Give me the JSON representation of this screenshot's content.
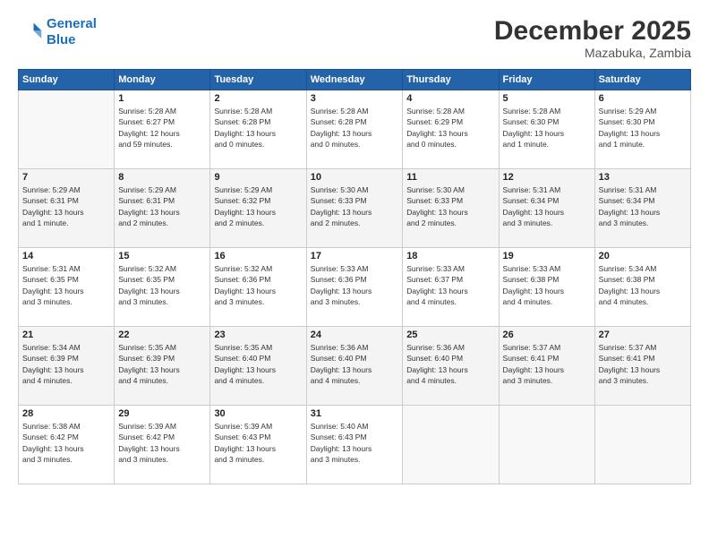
{
  "header": {
    "logo_line1": "General",
    "logo_line2": "Blue",
    "month": "December 2025",
    "location": "Mazabuka, Zambia"
  },
  "days_of_week": [
    "Sunday",
    "Monday",
    "Tuesday",
    "Wednesday",
    "Thursday",
    "Friday",
    "Saturday"
  ],
  "weeks": [
    [
      {
        "day": "",
        "detail": ""
      },
      {
        "day": "1",
        "detail": "Sunrise: 5:28 AM\nSunset: 6:27 PM\nDaylight: 12 hours\nand 59 minutes."
      },
      {
        "day": "2",
        "detail": "Sunrise: 5:28 AM\nSunset: 6:28 PM\nDaylight: 13 hours\nand 0 minutes."
      },
      {
        "day": "3",
        "detail": "Sunrise: 5:28 AM\nSunset: 6:28 PM\nDaylight: 13 hours\nand 0 minutes."
      },
      {
        "day": "4",
        "detail": "Sunrise: 5:28 AM\nSunset: 6:29 PM\nDaylight: 13 hours\nand 0 minutes."
      },
      {
        "day": "5",
        "detail": "Sunrise: 5:28 AM\nSunset: 6:30 PM\nDaylight: 13 hours\nand 1 minute."
      },
      {
        "day": "6",
        "detail": "Sunrise: 5:29 AM\nSunset: 6:30 PM\nDaylight: 13 hours\nand 1 minute."
      }
    ],
    [
      {
        "day": "7",
        "detail": "Sunrise: 5:29 AM\nSunset: 6:31 PM\nDaylight: 13 hours\nand 1 minute."
      },
      {
        "day": "8",
        "detail": "Sunrise: 5:29 AM\nSunset: 6:31 PM\nDaylight: 13 hours\nand 2 minutes."
      },
      {
        "day": "9",
        "detail": "Sunrise: 5:29 AM\nSunset: 6:32 PM\nDaylight: 13 hours\nand 2 minutes."
      },
      {
        "day": "10",
        "detail": "Sunrise: 5:30 AM\nSunset: 6:33 PM\nDaylight: 13 hours\nand 2 minutes."
      },
      {
        "day": "11",
        "detail": "Sunrise: 5:30 AM\nSunset: 6:33 PM\nDaylight: 13 hours\nand 2 minutes."
      },
      {
        "day": "12",
        "detail": "Sunrise: 5:31 AM\nSunset: 6:34 PM\nDaylight: 13 hours\nand 3 minutes."
      },
      {
        "day": "13",
        "detail": "Sunrise: 5:31 AM\nSunset: 6:34 PM\nDaylight: 13 hours\nand 3 minutes."
      }
    ],
    [
      {
        "day": "14",
        "detail": "Sunrise: 5:31 AM\nSunset: 6:35 PM\nDaylight: 13 hours\nand 3 minutes."
      },
      {
        "day": "15",
        "detail": "Sunrise: 5:32 AM\nSunset: 6:35 PM\nDaylight: 13 hours\nand 3 minutes."
      },
      {
        "day": "16",
        "detail": "Sunrise: 5:32 AM\nSunset: 6:36 PM\nDaylight: 13 hours\nand 3 minutes."
      },
      {
        "day": "17",
        "detail": "Sunrise: 5:33 AM\nSunset: 6:36 PM\nDaylight: 13 hours\nand 3 minutes."
      },
      {
        "day": "18",
        "detail": "Sunrise: 5:33 AM\nSunset: 6:37 PM\nDaylight: 13 hours\nand 4 minutes."
      },
      {
        "day": "19",
        "detail": "Sunrise: 5:33 AM\nSunset: 6:38 PM\nDaylight: 13 hours\nand 4 minutes."
      },
      {
        "day": "20",
        "detail": "Sunrise: 5:34 AM\nSunset: 6:38 PM\nDaylight: 13 hours\nand 4 minutes."
      }
    ],
    [
      {
        "day": "21",
        "detail": "Sunrise: 5:34 AM\nSunset: 6:39 PM\nDaylight: 13 hours\nand 4 minutes."
      },
      {
        "day": "22",
        "detail": "Sunrise: 5:35 AM\nSunset: 6:39 PM\nDaylight: 13 hours\nand 4 minutes."
      },
      {
        "day": "23",
        "detail": "Sunrise: 5:35 AM\nSunset: 6:40 PM\nDaylight: 13 hours\nand 4 minutes."
      },
      {
        "day": "24",
        "detail": "Sunrise: 5:36 AM\nSunset: 6:40 PM\nDaylight: 13 hours\nand 4 minutes."
      },
      {
        "day": "25",
        "detail": "Sunrise: 5:36 AM\nSunset: 6:40 PM\nDaylight: 13 hours\nand 4 minutes."
      },
      {
        "day": "26",
        "detail": "Sunrise: 5:37 AM\nSunset: 6:41 PM\nDaylight: 13 hours\nand 3 minutes."
      },
      {
        "day": "27",
        "detail": "Sunrise: 5:37 AM\nSunset: 6:41 PM\nDaylight: 13 hours\nand 3 minutes."
      }
    ],
    [
      {
        "day": "28",
        "detail": "Sunrise: 5:38 AM\nSunset: 6:42 PM\nDaylight: 13 hours\nand 3 minutes."
      },
      {
        "day": "29",
        "detail": "Sunrise: 5:39 AM\nSunset: 6:42 PM\nDaylight: 13 hours\nand 3 minutes."
      },
      {
        "day": "30",
        "detail": "Sunrise: 5:39 AM\nSunset: 6:43 PM\nDaylight: 13 hours\nand 3 minutes."
      },
      {
        "day": "31",
        "detail": "Sunrise: 5:40 AM\nSunset: 6:43 PM\nDaylight: 13 hours\nand 3 minutes."
      },
      {
        "day": "",
        "detail": ""
      },
      {
        "day": "",
        "detail": ""
      },
      {
        "day": "",
        "detail": ""
      }
    ]
  ]
}
